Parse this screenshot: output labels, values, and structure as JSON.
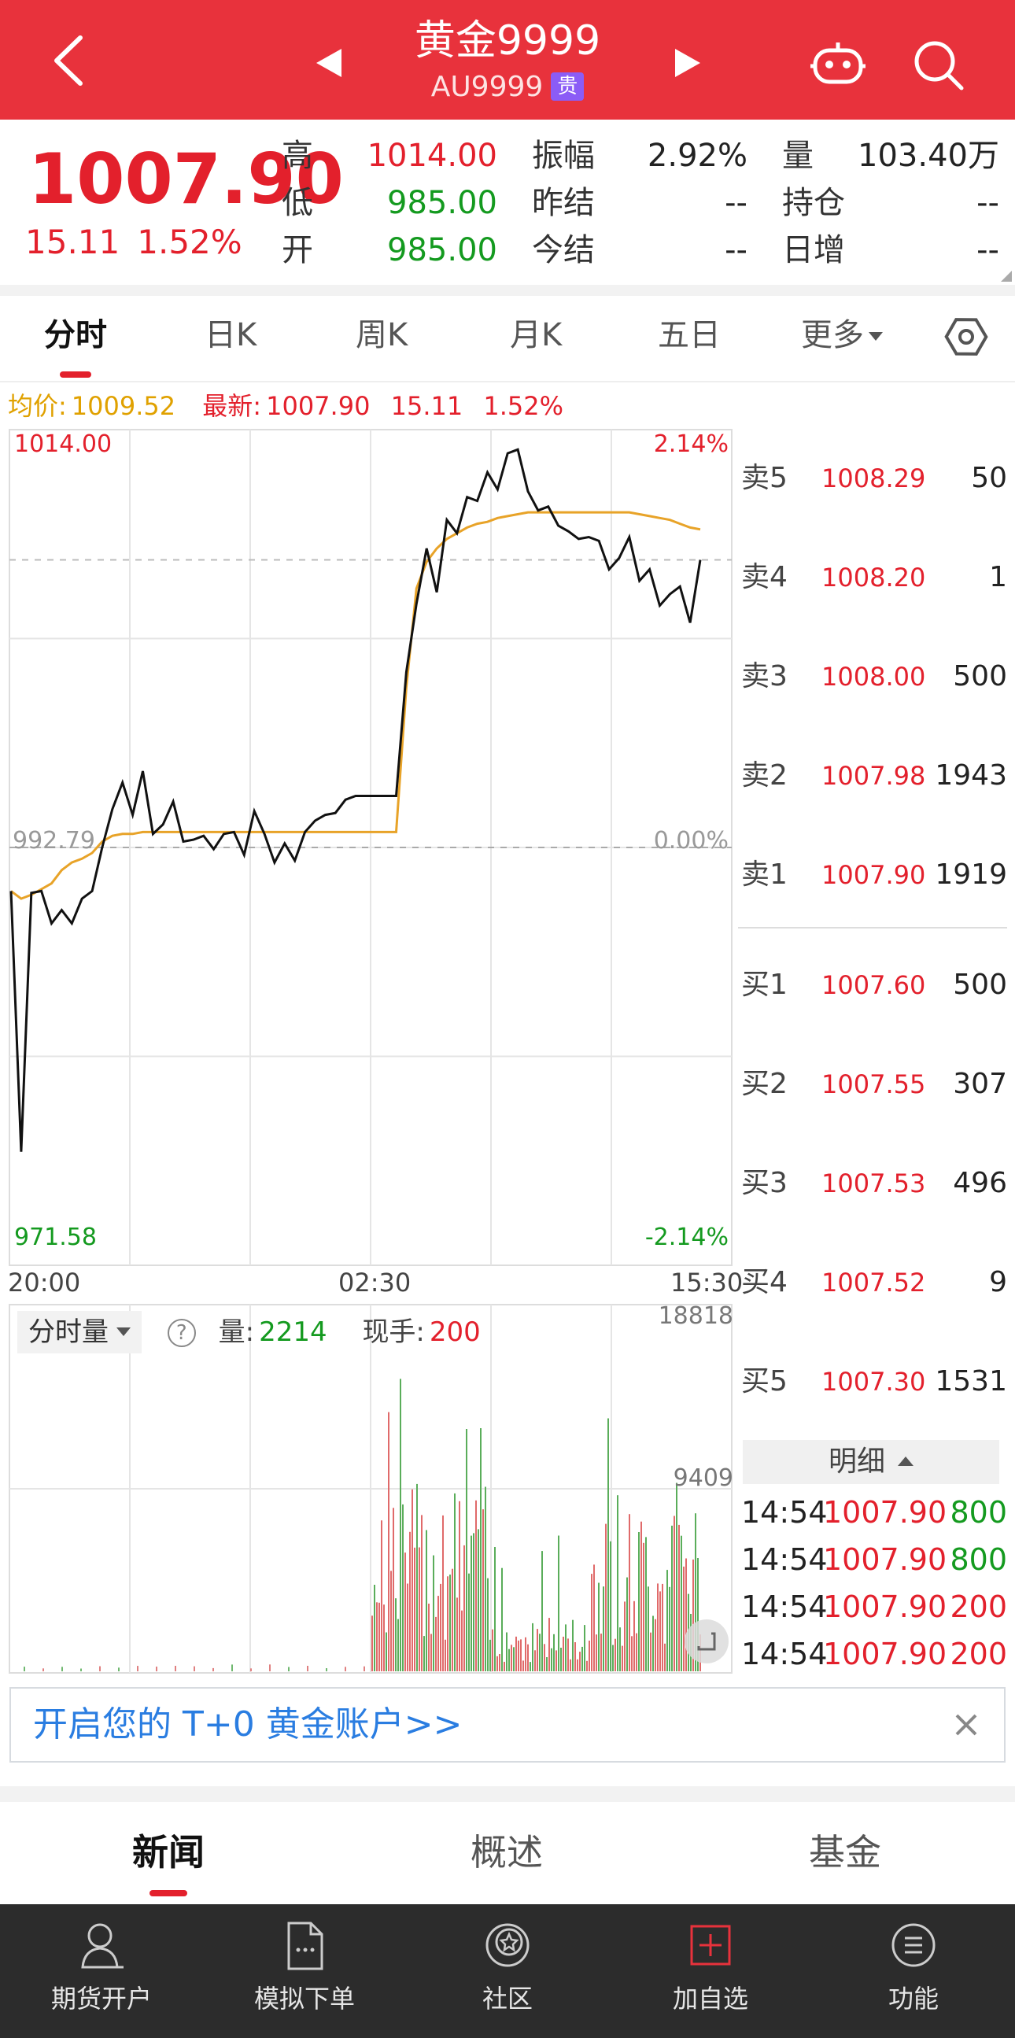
{
  "header": {
    "title": "黄金9999",
    "code": "AU9999",
    "badge": "贵"
  },
  "quote": {
    "price": "1007.90",
    "change": "15.11",
    "change_pct": "1.52%",
    "stats": {
      "high_label": "高",
      "high": "1014.00",
      "low_label": "低",
      "low": "985.00",
      "open_label": "开",
      "open": "985.00",
      "amplitude_label": "振幅",
      "amplitude": "2.92%",
      "prev_settle_label": "昨结",
      "prev_settle": "--",
      "settle_label": "今结",
      "settle": "--",
      "volume_label": "量",
      "volume": "103.40万",
      "open_interest_label": "持仓",
      "open_interest": "--",
      "daily_increase_label": "日增",
      "daily_increase": "--"
    }
  },
  "tabs": [
    "分时",
    "日K",
    "周K",
    "月K",
    "五日",
    "更多"
  ],
  "avg_line": {
    "avg_label": "均价:",
    "avg_value": "1009.52",
    "latest_label": "最新:",
    "latest_value": "1007.90",
    "change": "15.11",
    "change_pct": "1.52%"
  },
  "chart_labels": {
    "top_price": "1014.00",
    "top_pct": "2.14%",
    "mid_price": "992.79",
    "mid_pct": "0.00%",
    "bottom_price": "971.58",
    "bottom_pct": "-2.14%",
    "vol_max": "18818",
    "vol_mid": "9409"
  },
  "time_axis": [
    "20:00",
    "02:30",
    "15:30"
  ],
  "chart_data": {
    "type": "line",
    "x_label_ticks": [
      "20:00",
      "02:30",
      "15:30"
    ],
    "ylim": [
      971.58,
      1014.0
    ],
    "reference_price": 992.79,
    "series": [
      {
        "values": [
          990.5,
          976.8,
          990.4,
          990.5,
          988.8,
          989.5,
          988.8,
          990.1,
          990.5,
          992.8,
          994.8,
          996.2,
          994.5,
          996.8,
          993.5,
          994.0,
          995.2,
          993.1,
          993.2,
          993.4,
          992.7,
          993.5,
          993.6,
          992.4,
          994.7,
          993.5,
          992.0,
          993.0,
          992.1,
          993.6,
          994.2,
          994.5,
          994.6,
          995.3,
          995.5,
          995.5,
          995.5,
          995.5,
          995.5,
          1002.0,
          1005.6,
          1008.5,
          1006.2,
          1010.0,
          1009.3,
          1011.2,
          1011.0,
          1012.5,
          1011.6,
          1013.5,
          1013.7,
          1011.5,
          1010.5,
          1010.7,
          1009.7,
          1009.4,
          1009.0,
          1009.1,
          1008.9,
          1007.4,
          1008.0,
          1009.1,
          1006.8,
          1007.4,
          1005.5,
          1006.1,
          1006.5,
          1004.6,
          1007.9
        ]
      },
      {
        "values": [
          990.5,
          990.1,
          990.3,
          990.6,
          990.9,
          991.6,
          992.0,
          992.2,
          992.5,
          993.1,
          993.4,
          993.5,
          993.5,
          993.6,
          993.6,
          993.6,
          993.6,
          993.6,
          993.6,
          993.6,
          993.6,
          993.6,
          993.6,
          993.6,
          993.6,
          993.6,
          993.6,
          993.6,
          993.6,
          993.6,
          993.6,
          993.6,
          993.6,
          993.6,
          993.6,
          993.6,
          993.6,
          993.6,
          993.6,
          1001.2,
          1006.4,
          1007.8,
          1008.5,
          1009.0,
          1009.3,
          1009.6,
          1009.8,
          1009.9,
          1010.1,
          1010.2,
          1010.3,
          1010.4,
          1010.4,
          1010.4,
          1010.4,
          1010.4,
          1010.4,
          1010.4,
          1010.4,
          1010.4,
          1010.4,
          1010.4,
          1010.3,
          1010.2,
          1010.1,
          1010.0,
          1009.8,
          1009.6,
          1009.5
        ]
      }
    ]
  },
  "volume_panel": {
    "select_label": "分时量",
    "help_icon": "question-circle-icon",
    "vol_label": "量:",
    "vol_value": "2214",
    "hand_label": "现手:",
    "hand_value": "200"
  },
  "order_book": {
    "asks": [
      {
        "label": "卖5",
        "price": "1008.29",
        "qty": "50"
      },
      {
        "label": "卖4",
        "price": "1008.20",
        "qty": "1"
      },
      {
        "label": "卖3",
        "price": "1008.00",
        "qty": "500"
      },
      {
        "label": "卖2",
        "price": "1007.98",
        "qty": "1943"
      },
      {
        "label": "卖1",
        "price": "1007.90",
        "qty": "1919"
      }
    ],
    "bids": [
      {
        "label": "买1",
        "price": "1007.60",
        "qty": "500"
      },
      {
        "label": "买2",
        "price": "1007.55",
        "qty": "307"
      },
      {
        "label": "买3",
        "price": "1007.53",
        "qty": "496"
      },
      {
        "label": "买4",
        "price": "1007.52",
        "qty": "9"
      },
      {
        "label": "买5",
        "price": "1007.30",
        "qty": "1531"
      }
    ]
  },
  "details": {
    "header": "明细",
    "ticks": [
      {
        "time": "14:54",
        "price": "1007.90",
        "qty": "800"
      },
      {
        "time": "14:54",
        "price": "1007.90",
        "qty": "800"
      },
      {
        "time": "14:54",
        "price": "1007.90",
        "qty": "200"
      },
      {
        "time": "14:54",
        "price": "1007.90",
        "qty": "200"
      }
    ]
  },
  "banner": {
    "text": "开启您的 T+0 黄金账户>>"
  },
  "news_tabs": [
    "新闻",
    "概述",
    "基金"
  ],
  "bottom_nav": [
    {
      "label": "期货开户",
      "icon": "user-icon"
    },
    {
      "label": "模拟下单",
      "icon": "document-icon"
    },
    {
      "label": "社区",
      "icon": "star-badge-icon"
    },
    {
      "label": "加自选",
      "icon": "plus-square-icon"
    },
    {
      "label": "功能",
      "icon": "menu-circle-icon"
    }
  ],
  "colors": {
    "brand_red": "#e8323c",
    "up_red": "#e3202c",
    "down_green": "#149a1f",
    "avg_gold": "#e0a100",
    "link_blue": "#2a7de1"
  }
}
